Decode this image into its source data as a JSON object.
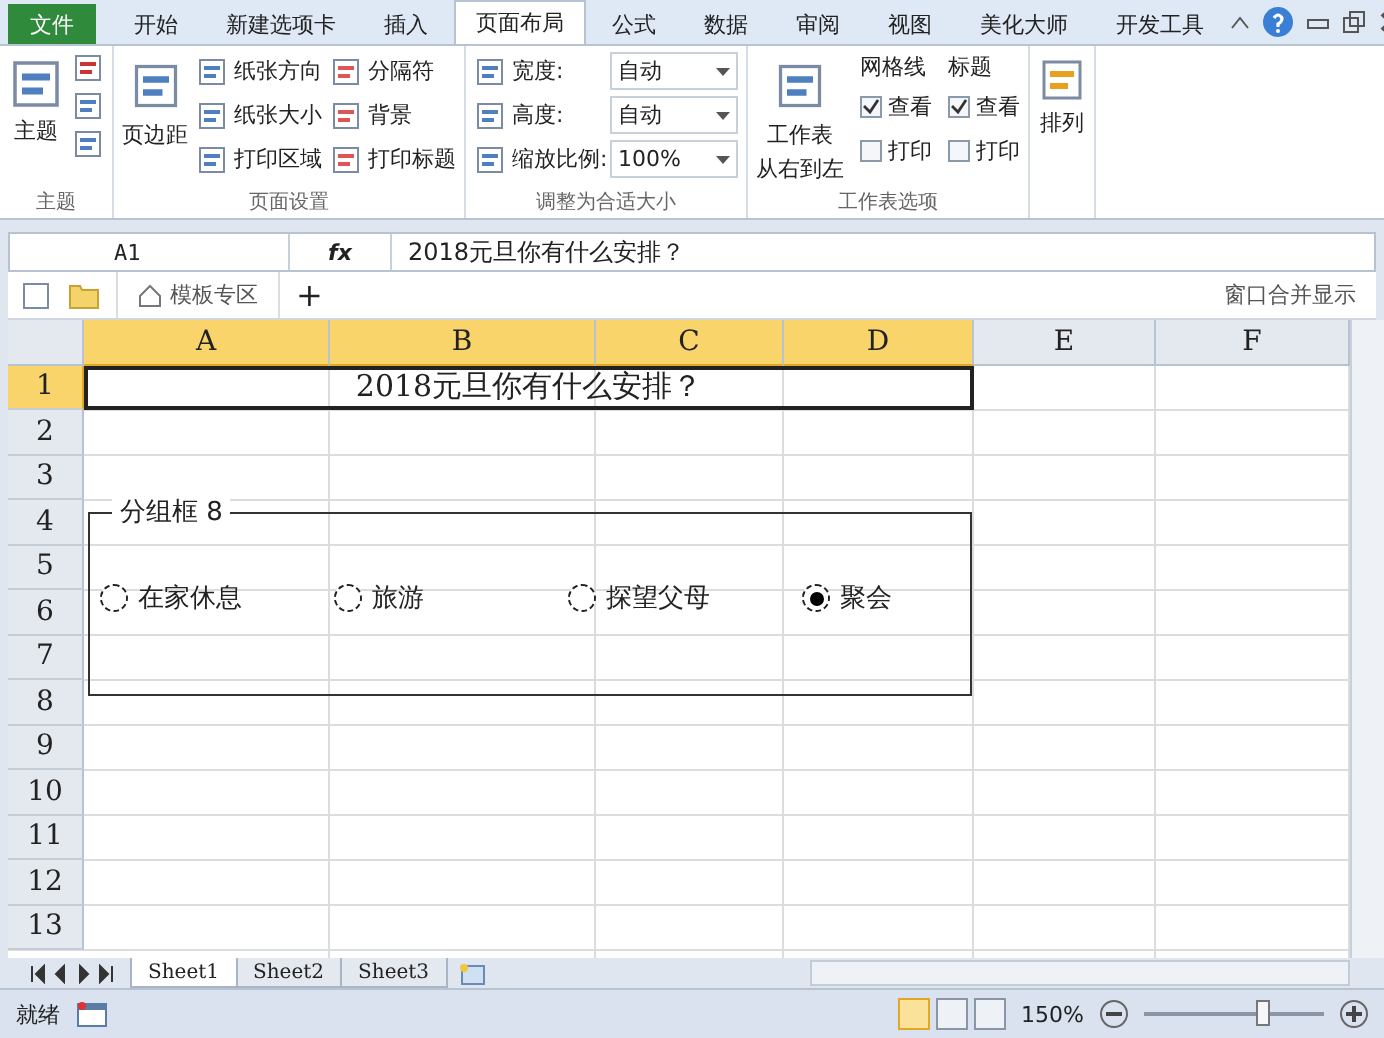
{
  "ribbon_tabs": [
    {
      "label": "文件",
      "kind": "file",
      "selected": false
    },
    {
      "label": "开始",
      "kind": "tab",
      "selected": false
    },
    {
      "label": "新建选项卡",
      "kind": "tab",
      "selected": false
    },
    {
      "label": "插入",
      "kind": "tab",
      "selected": false
    },
    {
      "label": "页面布局",
      "kind": "tab",
      "selected": true
    },
    {
      "label": "公式",
      "kind": "tab",
      "selected": false
    },
    {
      "label": "数据",
      "kind": "tab",
      "selected": false
    },
    {
      "label": "审阅",
      "kind": "tab",
      "selected": false
    },
    {
      "label": "视图",
      "kind": "tab",
      "selected": false
    },
    {
      "label": "美化大师",
      "kind": "tab",
      "selected": false
    },
    {
      "label": "开发工具",
      "kind": "tab",
      "selected": false
    }
  ],
  "ribbon": {
    "theme": {
      "button": "主题",
      "caption": "主题"
    },
    "page_setup": {
      "margins": "页边距",
      "column_1": [
        "纸张方向",
        "纸张大小",
        "打印区域"
      ],
      "column_2": [
        "分隔符",
        "背景",
        "打印标题"
      ],
      "caption": "页面设置"
    },
    "scale": {
      "rows": [
        {
          "label": "宽度:",
          "value": "自动"
        },
        {
          "label": "高度:",
          "value": "自动"
        },
        {
          "label": "缩放比例:",
          "value": "100%"
        }
      ],
      "caption": "调整为合适大小"
    },
    "sheet_options": {
      "rtl": [
        "工作表",
        "从右到左"
      ],
      "groups": [
        {
          "title": "网格线",
          "options": [
            {
              "label": "查看",
              "checked": true
            },
            {
              "label": "打印",
              "checked": false
            }
          ]
        },
        {
          "title": "标题",
          "options": [
            {
              "label": "查看",
              "checked": true
            },
            {
              "label": "打印",
              "checked": false
            }
          ]
        }
      ],
      "caption": "工作表选项"
    },
    "arrange": {
      "button": "排列"
    }
  },
  "name_box": "A1",
  "fx": "fx",
  "formula": "2018元旦你有什么安排？",
  "doc_toolbar": {
    "tab": "模板专区",
    "plus": "+",
    "merge": "窗口合并显示"
  },
  "columns": [
    {
      "label": "A",
      "selected": true
    },
    {
      "label": "B",
      "selected": true
    },
    {
      "label": "C",
      "selected": true
    },
    {
      "label": "D",
      "selected": true
    },
    {
      "label": "E",
      "selected": false
    },
    {
      "label": "F",
      "selected": false
    }
  ],
  "rows": [
    {
      "label": "1",
      "selected": true
    },
    {
      "label": "2",
      "selected": false
    },
    {
      "label": "3",
      "selected": false
    },
    {
      "label": "4",
      "selected": false
    },
    {
      "label": "5",
      "selected": false
    },
    {
      "label": "6",
      "selected": false
    },
    {
      "label": "7",
      "selected": false
    },
    {
      "label": "8",
      "selected": false
    },
    {
      "label": "9",
      "selected": false
    },
    {
      "label": "10",
      "selected": false
    },
    {
      "label": "11",
      "selected": false
    },
    {
      "label": "12",
      "selected": false
    },
    {
      "label": "13",
      "selected": false
    }
  ],
  "title_cell": "2018元旦你有什么安排？",
  "group_box": {
    "caption": "分组框 8",
    "options": [
      {
        "label": "在家休息",
        "selected": false
      },
      {
        "label": "旅游",
        "selected": false
      },
      {
        "label": "探望父母",
        "selected": false
      },
      {
        "label": "聚会",
        "selected": true
      }
    ]
  },
  "sheets": [
    {
      "label": "Sheet1",
      "selected": true
    },
    {
      "label": "Sheet2",
      "selected": false
    },
    {
      "label": "Sheet3",
      "selected": false
    }
  ],
  "status": {
    "ready": "就绪",
    "zoom": "150%",
    "level": 0.65
  }
}
